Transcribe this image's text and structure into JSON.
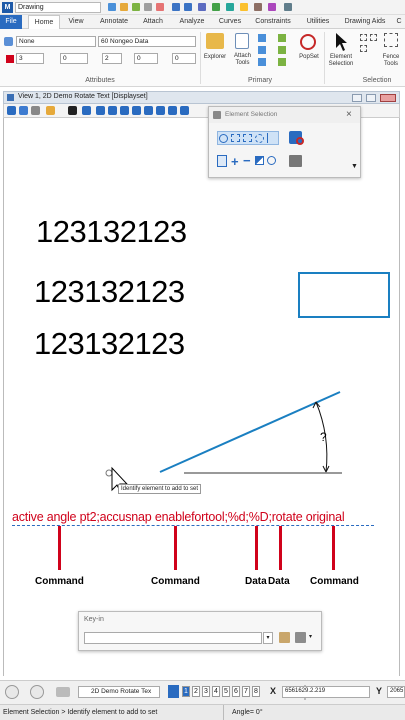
{
  "app": {
    "workspace": "Drawing",
    "logo": "M"
  },
  "tabs": {
    "file": "File",
    "home": "Home",
    "view": "View",
    "annotate": "Annotate",
    "attach": "Attach",
    "analyze": "Analyze",
    "curves": "Curves",
    "constraints": "Constraints",
    "utilities": "Utilities",
    "drawing_aids": "Drawing Aids",
    "more": "C"
  },
  "ribbon": {
    "level": "None",
    "textstyle": "60 Nongeo Data",
    "color": "3",
    "style": "0",
    "weight": "2",
    "class": "0",
    "trans": "0",
    "group_attributes": "Attributes",
    "explorer": "Explorer",
    "attach_tools": "Attach Tools",
    "popset": "PopSet",
    "group_primary": "Primary",
    "element_selection": "Element Selection",
    "fence_tools": "Fence Tools",
    "group_selection": "Selection"
  },
  "view": {
    "title": "View 1, 2D Demo Rotate Text [Displayset]"
  },
  "selection_panel": {
    "title": "Element Selection"
  },
  "canvas": {
    "text1": "123132123",
    "text2": "123132123",
    "text3": "123132123",
    "question": "?",
    "tooltip": "Identify element to add to set"
  },
  "command": {
    "line": "active angle pt2;accusnap enablefortool;%d;%D;rotate original",
    "labels": [
      "Command",
      "Command",
      "Data",
      "Data",
      "Command"
    ]
  },
  "keyin": {
    "title": "Key-in",
    "value": ""
  },
  "statusbar": {
    "model": "2D Demo Rotate Tex",
    "pages": [
      "1",
      "2",
      "3",
      "4",
      "5",
      "6",
      "7",
      "8"
    ],
    "x_label": "X",
    "x_value": "6561629.2.219",
    "y_label": "Y",
    "y_value": "2065",
    "message": "Element Selection > Identify element to add to set",
    "angle": "Angle= 0°"
  },
  "colors": {
    "accent": "#2a6bc0",
    "line": "#1a7fc1",
    "command": "#d0021b"
  }
}
